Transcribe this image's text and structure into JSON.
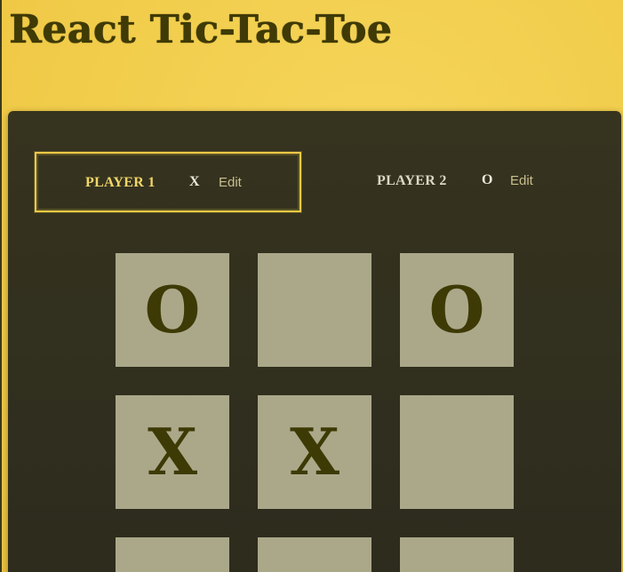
{
  "header": {
    "title": "React Tic-Tac-Toe"
  },
  "players": [
    {
      "name": "Player 1",
      "symbol": "X",
      "edit_label": "Edit",
      "active": true
    },
    {
      "name": "Player 2",
      "symbol": "O",
      "edit_label": "Edit",
      "active": false
    }
  ],
  "board": {
    "cells": [
      [
        "O",
        "",
        "O"
      ],
      [
        "X",
        "X",
        ""
      ],
      [
        "",
        "",
        ""
      ]
    ]
  },
  "colors": {
    "background": "#f1cc4a",
    "panel": "#322f1e",
    "active_border": "#f1c947",
    "cell": "#aba88a",
    "symbol": "#3d3a06"
  }
}
